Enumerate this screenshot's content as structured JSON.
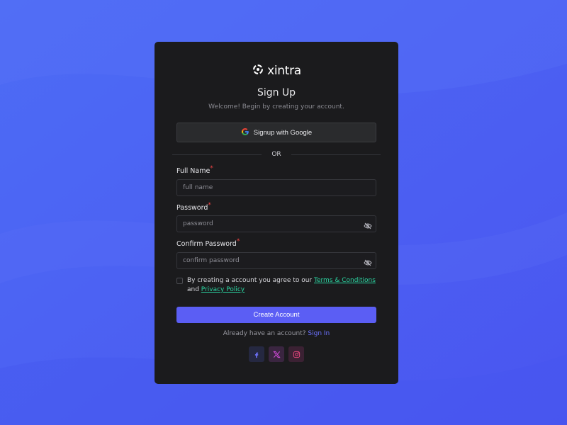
{
  "brand": {
    "name": "xintra"
  },
  "header": {
    "title": "Sign Up",
    "subtitle": "Welcome! Begin by creating your account."
  },
  "google": {
    "label": "Signup with Google",
    "icon": "google-icon"
  },
  "divider": {
    "text": "OR"
  },
  "form": {
    "full_name": {
      "label": "Full Name",
      "required_mark": "*",
      "placeholder": "full name",
      "value": ""
    },
    "password": {
      "label": "Password",
      "required_mark": "*",
      "placeholder": "password",
      "value": "",
      "toggle_icon": "eye-off-icon"
    },
    "confirm_password": {
      "label": "Confirm Password",
      "required_mark": "*",
      "placeholder": "confirm password",
      "value": "",
      "toggle_icon": "eye-off-icon"
    }
  },
  "terms": {
    "checked": false,
    "text_before": "By creating a account you agree to our ",
    "terms_link": "Terms & Conditions",
    "text_and": " and ",
    "privacy_link": "Privacy Policy"
  },
  "submit": {
    "label": "Create Account"
  },
  "signin": {
    "prompt": "Already have an account? ",
    "link": "Sign In"
  },
  "socials": [
    {
      "name": "facebook",
      "icon": "facebook-icon"
    },
    {
      "name": "x",
      "icon": "x-icon"
    },
    {
      "name": "instagram",
      "icon": "instagram-icon"
    }
  ],
  "colors": {
    "background": "#4f5ff2",
    "card": "#1b1b1d",
    "primary": "#5b5ef4",
    "link_green": "#2bd4a1",
    "link_blue": "#6c72ff",
    "required": "#ef4444"
  }
}
